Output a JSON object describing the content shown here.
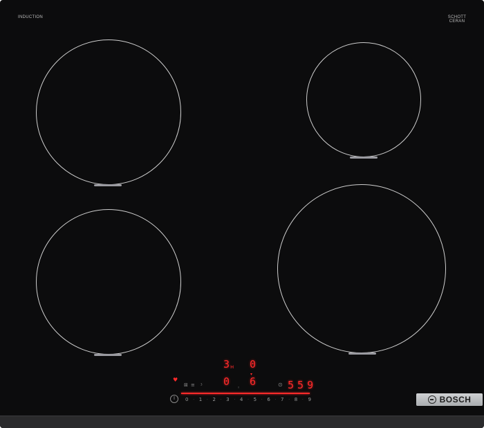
{
  "branding": {
    "induction_label": "INDUCTION",
    "schott_label": "SCHOTT CERAN",
    "brand": "BOSCH"
  },
  "display": {
    "rear_left": "3",
    "rear_left_suffix": "ʜ",
    "rear_right": "0",
    "front_left": "0",
    "front_right": "6",
    "timer": "5 5 9"
  },
  "slider": {
    "power_key": "I",
    "steps": [
      "0",
      "1",
      "2",
      "3",
      "4",
      "5",
      "6",
      "7",
      "8",
      "9"
    ]
  },
  "colors": {
    "glass": "#0c0c0d",
    "zone_outline": "#cfcfcf",
    "led": "#ff2a2a",
    "brand_plate": "#bfc1c3"
  },
  "icons": {
    "power": "power-icon",
    "timer": "clock-icon",
    "lock": "child-lock-icon",
    "wifi": "wifi-icon"
  }
}
